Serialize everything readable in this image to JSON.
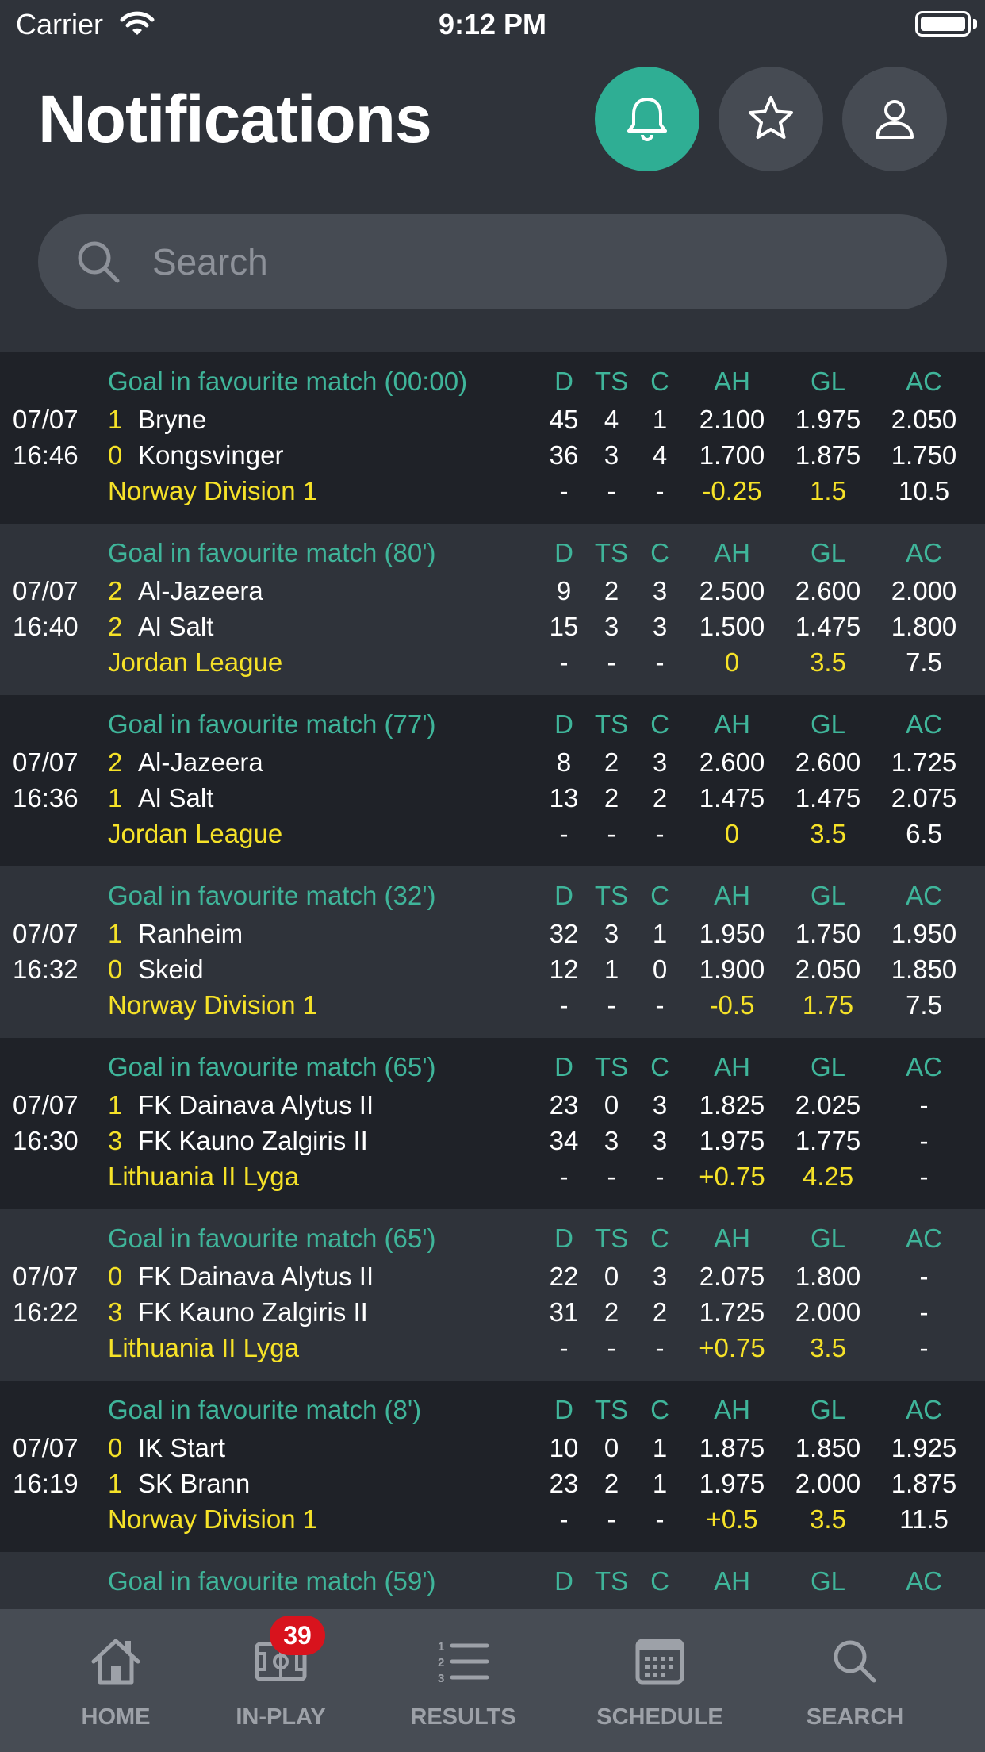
{
  "status_bar": {
    "carrier": "Carrier",
    "time": "9:12 PM"
  },
  "header": {
    "title": "Notifications",
    "icons": [
      "bell-icon",
      "star-icon",
      "user-icon"
    ]
  },
  "search": {
    "placeholder": "Search",
    "value": ""
  },
  "columns": [
    "D",
    "TS",
    "C",
    "AH",
    "GL",
    "AC"
  ],
  "colors": {
    "accent_teal": "#3fb59a",
    "highlight_yellow": "#f6e228",
    "badge_red": "#d8131d",
    "active_button": "#2fae94"
  },
  "matches": [
    {
      "notif": "Goal in favourite match (00:00)",
      "date": "07/07",
      "time": "16:46",
      "home_score": "1",
      "home": "Bryne",
      "away_score": "0",
      "away": "Kongsvinger",
      "league": "Norway Division 1",
      "home_stats": [
        "45",
        "4",
        "1",
        "2.100",
        "1.975",
        "2.050"
      ],
      "away_stats": [
        "36",
        "3",
        "4",
        "1.700",
        "1.875",
        "1.750"
      ],
      "line_stats": [
        "-",
        "-",
        "-",
        "-0.25",
        "1.5",
        "10.5"
      ]
    },
    {
      "notif": "Goal in favourite match (80')",
      "date": "07/07",
      "time": "16:40",
      "home_score": "2",
      "home": "Al-Jazeera",
      "away_score": "2",
      "away": "Al Salt",
      "league": "Jordan League",
      "home_stats": [
        "9",
        "2",
        "3",
        "2.500",
        "2.600",
        "2.000"
      ],
      "away_stats": [
        "15",
        "3",
        "3",
        "1.500",
        "1.475",
        "1.800"
      ],
      "line_stats": [
        "-",
        "-",
        "-",
        "0",
        "3.5",
        "7.5"
      ]
    },
    {
      "notif": "Goal in favourite match (77')",
      "date": "07/07",
      "time": "16:36",
      "home_score": "2",
      "home": "Al-Jazeera",
      "away_score": "1",
      "away": "Al Salt",
      "league": "Jordan League",
      "home_stats": [
        "8",
        "2",
        "3",
        "2.600",
        "2.600",
        "1.725"
      ],
      "away_stats": [
        "13",
        "2",
        "2",
        "1.475",
        "1.475",
        "2.075"
      ],
      "line_stats": [
        "-",
        "-",
        "-",
        "0",
        "3.5",
        "6.5"
      ]
    },
    {
      "notif": "Goal in favourite match (32')",
      "date": "07/07",
      "time": "16:32",
      "home_score": "1",
      "home": "Ranheim",
      "away_score": "0",
      "away": "Skeid",
      "league": "Norway Division 1",
      "home_stats": [
        "32",
        "3",
        "1",
        "1.950",
        "1.750",
        "1.950"
      ],
      "away_stats": [
        "12",
        "1",
        "0",
        "1.900",
        "2.050",
        "1.850"
      ],
      "line_stats": [
        "-",
        "-",
        "-",
        "-0.5",
        "1.75",
        "7.5"
      ]
    },
    {
      "notif": "Goal in favourite match (65')",
      "date": "07/07",
      "time": "16:30",
      "home_score": "1",
      "home": "FK Dainava Alytus II",
      "away_score": "3",
      "away": "FK Kauno Zalgiris II",
      "league": "Lithuania II Lyga",
      "home_stats": [
        "23",
        "0",
        "3",
        "1.825",
        "2.025",
        "-"
      ],
      "away_stats": [
        "34",
        "3",
        "3",
        "1.975",
        "1.775",
        "-"
      ],
      "line_stats": [
        "-",
        "-",
        "-",
        "+0.75",
        "4.25",
        "-"
      ]
    },
    {
      "notif": "Goal in favourite match (65')",
      "date": "07/07",
      "time": "16:22",
      "home_score": "0",
      "home": "FK Dainava Alytus II",
      "away_score": "3",
      "away": "FK Kauno Zalgiris II",
      "league": "Lithuania II Lyga",
      "home_stats": [
        "22",
        "0",
        "3",
        "2.075",
        "1.800",
        "-"
      ],
      "away_stats": [
        "31",
        "2",
        "2",
        "1.725",
        "2.000",
        "-"
      ],
      "line_stats": [
        "-",
        "-",
        "-",
        "+0.75",
        "3.5",
        "-"
      ]
    },
    {
      "notif": "Goal in favourite match (8')",
      "date": "07/07",
      "time": "16:19",
      "home_score": "0",
      "home": "IK Start",
      "away_score": "1",
      "away": "SK Brann",
      "league": "Norway Division 1",
      "home_stats": [
        "10",
        "0",
        "1",
        "1.875",
        "1.850",
        "1.925"
      ],
      "away_stats": [
        "23",
        "2",
        "1",
        "1.975",
        "2.000",
        "1.875"
      ],
      "line_stats": [
        "-",
        "-",
        "-",
        "+0.5",
        "3.5",
        "11.5"
      ]
    }
  ],
  "partial_match": {
    "notif": "Goal in favourite match (59')"
  },
  "tabbar": {
    "items": [
      {
        "label": "HOME",
        "icon": "home-icon"
      },
      {
        "label": "IN-PLAY",
        "icon": "pitch-icon",
        "badge": "39"
      },
      {
        "label": "RESULTS",
        "icon": "numbered-list-icon"
      },
      {
        "label": "SCHEDULE",
        "icon": "calendar-icon"
      },
      {
        "label": "SEARCH",
        "icon": "search-icon"
      }
    ]
  }
}
